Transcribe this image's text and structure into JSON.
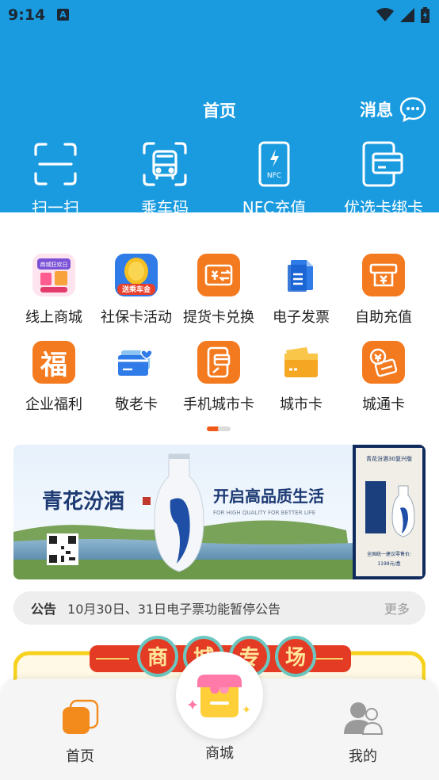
{
  "status_bar": {
    "time": "9:14",
    "badge": "A"
  },
  "header": {
    "title": "首页",
    "message_label": "消息"
  },
  "quick_actions": [
    {
      "label": "扫一扫",
      "icon": "scan-icon"
    },
    {
      "label": "乘车码",
      "icon": "bus-icon"
    },
    {
      "label": "NFC充值",
      "icon": "nfc-phone-icon",
      "icon_text": "NFC"
    },
    {
      "label": "优选卡绑卡",
      "icon": "card-bind-icon"
    }
  ],
  "services": [
    {
      "label": "线上商城",
      "icon": "mall-festival-icon",
      "icon_text": "商城狂欢日"
    },
    {
      "label": "社保卡活动",
      "icon": "coin-icon",
      "icon_text": "送乘车金"
    },
    {
      "label": "提货卡兑换",
      "icon": "exchange-card-icon"
    },
    {
      "label": "电子发票",
      "icon": "invoice-icon"
    },
    {
      "label": "自助充值",
      "icon": "atm-icon"
    },
    {
      "label": "企业福利",
      "icon": "fu-icon",
      "icon_text": "福"
    },
    {
      "label": "敬老卡",
      "icon": "elder-card-icon"
    },
    {
      "label": "手机城市卡",
      "icon": "phone-card-icon"
    },
    {
      "label": "城市卡",
      "icon": "city-card-icon"
    },
    {
      "label": "城通卡",
      "icon": "city-pass-icon"
    }
  ],
  "banner": {
    "brand": "青花汾酒",
    "slogan": "开启高品质生活",
    "slogan_en": "FOR HIGH QUALITY FOR BETTER LIFE",
    "side_title": "青花汾酒30复兴版",
    "side_price_label": "全国统一建议零售价:",
    "side_price": "1199元/盒"
  },
  "notice": {
    "tag": "公告",
    "text": "10月30日、31日电子票功能暂停公告",
    "more": "更多"
  },
  "mall_banner": {
    "chars": [
      "商",
      "城",
      "专",
      "场"
    ]
  },
  "bottom_nav": [
    {
      "label": "首页"
    },
    {
      "label": "商城"
    },
    {
      "label": "我的"
    }
  ],
  "colors": {
    "primary_blue": "#1a9be0",
    "accent_orange": "#f47a1f",
    "page_bg": "#ffffff"
  }
}
